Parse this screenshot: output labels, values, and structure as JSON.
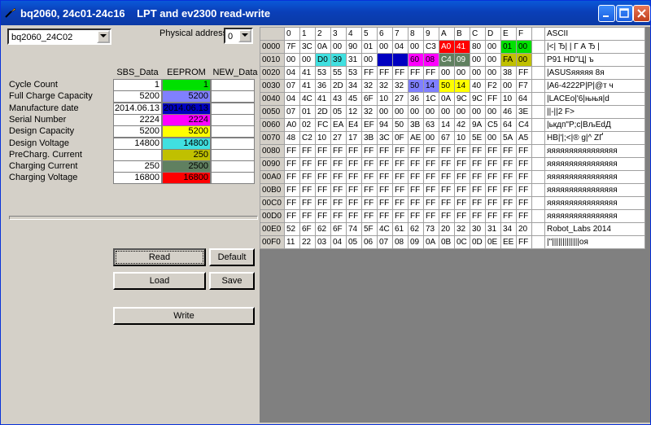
{
  "window": {
    "title": "bq2060, 24c01-24c16    LPT and ev2300 read-write"
  },
  "left": {
    "chip_select": "bq2060_24C02",
    "physical_address_label": "Physical address",
    "physical_address_value": "0",
    "col_headers": [
      "SBS_Data",
      "EEPROM",
      "NEW_Data"
    ],
    "rows": [
      {
        "label": "Cycle Count",
        "sbs": "1",
        "eeprom": "1",
        "eeprom_color": "#00e000",
        "new": ""
      },
      {
        "label": "Full Charge Capacity",
        "sbs": "5200",
        "eeprom": "5200",
        "eeprom_color": "#8080ff",
        "new": ""
      },
      {
        "label": "Manufacture date",
        "sbs": "2014.06.13",
        "eeprom": "2014.06.13",
        "eeprom_color": "#0000c0",
        "new": ""
      },
      {
        "label": "Serial Number",
        "sbs": "2224",
        "eeprom": "2224",
        "eeprom_color": "#ff00ff",
        "new": ""
      },
      {
        "label": "Design Capacity",
        "sbs": "5200",
        "eeprom": "5200",
        "eeprom_color": "#ffff00",
        "new": ""
      },
      {
        "label": "Design Voltage",
        "sbs": "14800",
        "eeprom": "14800",
        "eeprom_color": "#40e0e0",
        "new": ""
      },
      {
        "label": "PreCharg. Current",
        "sbs": "",
        "eeprom": "250",
        "eeprom_color": "#c0c000",
        "new": ""
      },
      {
        "label": "Charging Current",
        "sbs": "250",
        "eeprom": "2500",
        "eeprom_color": "#608060",
        "new": ""
      },
      {
        "label": "Charging Voltage",
        "sbs": "16800",
        "eeprom": "16800",
        "eeprom_color": "#ff0000",
        "new": ""
      }
    ],
    "buttons": {
      "read": "Read",
      "default": "Default",
      "load": "Load",
      "save": "Save",
      "write": "Write"
    }
  },
  "hex": {
    "col_headers": [
      "0",
      "1",
      "2",
      "3",
      "4",
      "5",
      "6",
      "7",
      "8",
      "9",
      "A",
      "B",
      "C",
      "D",
      "E",
      "F"
    ],
    "ascii_header": "ASCII",
    "rows": [
      {
        "addr": "0000",
        "bytes": [
          "7F",
          "3C",
          "0A",
          "00",
          "90",
          "01",
          "00",
          "04",
          "00",
          "C3",
          "A0",
          "41",
          "80",
          "00",
          "01",
          "00"
        ],
        "ascii": "|<| Ђ| | Г А Ђ  |"
      },
      {
        "addr": "0010",
        "bytes": [
          "00",
          "00",
          "D0",
          "39",
          "31",
          "00",
          "",
          "",
          "60",
          "08",
          "C4",
          "09",
          "00",
          "00",
          "FA",
          "00"
        ],
        "ascii": "  Р91  HD\"Ц|   ъ"
      },
      {
        "addr": "0020",
        "bytes": [
          "04",
          "41",
          "53",
          "55",
          "53",
          "FF",
          "FF",
          "FF",
          "FF",
          "FF",
          "00",
          "00",
          "00",
          "00",
          "38",
          "FF"
        ],
        "ascii": "|ASUSяяяяя    8я"
      },
      {
        "addr": "0030",
        "bytes": [
          "07",
          "41",
          "36",
          "2D",
          "34",
          "32",
          "32",
          "32",
          "50",
          "14",
          "50",
          "14",
          "40",
          "F2",
          "00",
          "F7"
        ],
        "ascii": "|A6-4222P|P|@т  ч"
      },
      {
        "addr": "0040",
        "bytes": [
          "04",
          "4C",
          "41",
          "43",
          "45",
          "6F",
          "10",
          "27",
          "36",
          "1C",
          "0A",
          "9C",
          "9C",
          "FF",
          "10",
          "64"
        ],
        "ascii": "|LACEo|'6|њњя|d"
      },
      {
        "addr": "0050",
        "bytes": [
          "07",
          "01",
          "2D",
          "05",
          "12",
          "32",
          "00",
          "00",
          "00",
          "00",
          "00",
          "00",
          "00",
          "00",
          "46",
          "3E"
        ],
        "ascii": "||-||2          F>"
      },
      {
        "addr": "0060",
        "bytes": [
          "A0",
          "02",
          "FC",
          "EA",
          "E4",
          "EF",
          "94",
          "50",
          "3B",
          "63",
          "14",
          "42",
          "9A",
          "C5",
          "64",
          "C4"
        ],
        "ascii": " |ькдп\"P;c|BљЕdД"
      },
      {
        "addr": "0070",
        "bytes": [
          "48",
          "C2",
          "10",
          "27",
          "17",
          "3B",
          "3C",
          "0F",
          "AE",
          "00",
          "67",
          "10",
          "5E",
          "00",
          "5A",
          "A5"
        ],
        "ascii": "HВ|'|;<|® g|^ ZҐ"
      },
      {
        "addr": "0080",
        "bytes": [
          "FF",
          "FF",
          "FF",
          "FF",
          "FF",
          "FF",
          "FF",
          "FF",
          "FF",
          "FF",
          "FF",
          "FF",
          "FF",
          "FF",
          "FF",
          "FF"
        ],
        "ascii": "яяяяяяяяяяяяяяяя"
      },
      {
        "addr": "0090",
        "bytes": [
          "FF",
          "FF",
          "FF",
          "FF",
          "FF",
          "FF",
          "FF",
          "FF",
          "FF",
          "FF",
          "FF",
          "FF",
          "FF",
          "FF",
          "FF",
          "FF"
        ],
        "ascii": "яяяяяяяяяяяяяяяя"
      },
      {
        "addr": "00A0",
        "bytes": [
          "FF",
          "FF",
          "FF",
          "FF",
          "FF",
          "FF",
          "FF",
          "FF",
          "FF",
          "FF",
          "FF",
          "FF",
          "FF",
          "FF",
          "FF",
          "FF"
        ],
        "ascii": "яяяяяяяяяяяяяяяя"
      },
      {
        "addr": "00B0",
        "bytes": [
          "FF",
          "FF",
          "FF",
          "FF",
          "FF",
          "FF",
          "FF",
          "FF",
          "FF",
          "FF",
          "FF",
          "FF",
          "FF",
          "FF",
          "FF",
          "FF"
        ],
        "ascii": "яяяяяяяяяяяяяяяя"
      },
      {
        "addr": "00C0",
        "bytes": [
          "FF",
          "FF",
          "FF",
          "FF",
          "FF",
          "FF",
          "FF",
          "FF",
          "FF",
          "FF",
          "FF",
          "FF",
          "FF",
          "FF",
          "FF",
          "FF"
        ],
        "ascii": "яяяяяяяяяяяяяяяя"
      },
      {
        "addr": "00D0",
        "bytes": [
          "FF",
          "FF",
          "FF",
          "FF",
          "FF",
          "FF",
          "FF",
          "FF",
          "FF",
          "FF",
          "FF",
          "FF",
          "FF",
          "FF",
          "FF",
          "FF"
        ],
        "ascii": "яяяяяяяяяяяяяяяя"
      },
      {
        "addr": "00E0",
        "bytes": [
          "52",
          "6F",
          "62",
          "6F",
          "74",
          "5F",
          "4C",
          "61",
          "62",
          "73",
          "20",
          "32",
          "30",
          "31",
          "34",
          "20"
        ],
        "ascii": "Robot_Labs 2014"
      },
      {
        "addr": "00F0",
        "bytes": [
          "11",
          "22",
          "03",
          "04",
          "05",
          "06",
          "07",
          "08",
          "09",
          "0A",
          "0B",
          "0C",
          "0D",
          "0E",
          "EE",
          "FF"
        ],
        "ascii": "|\"|||||||||||||оя"
      }
    ],
    "highlights": {
      "0000": {
        "10": "#ff0000",
        "11": "#ff0000",
        "14": "#00e000",
        "15": "#00e000"
      },
      "0010": {
        "2": "#40e0e0",
        "3": "#40e0e0",
        "6": "#0000c0",
        "7": "#0000c0",
        "8": "#ff00ff",
        "9": "#ff00ff",
        "10": "#608060",
        "11": "#608060",
        "14": "#c0c000",
        "15": "#c0c000"
      },
      "0030": {
        "8": "#8080ff",
        "9": "#8080ff",
        "10": "#ffff00",
        "11": "#ffff00"
      }
    }
  }
}
